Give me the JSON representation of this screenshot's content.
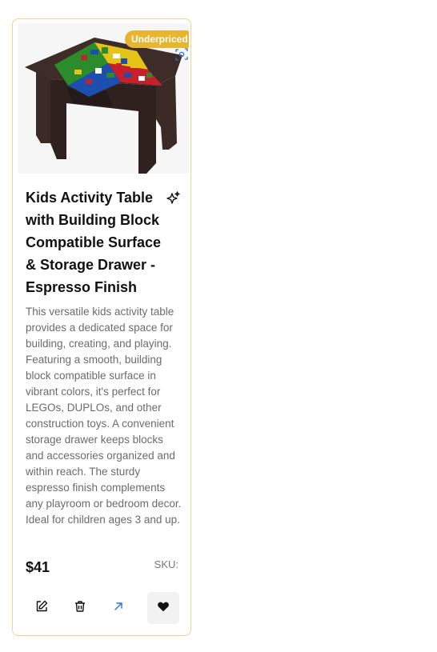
{
  "product": {
    "badge": "Underpriced",
    "title": "Kids Activity Table with Building Block Compatible Surface & Storage Drawer - Espresso Finish",
    "description": "This versatile kids activity table provides a dedicated space for building, creating, and playing. Featuring a smooth, building block compatible surface in vibrant colors, it's perfect for LEGOs, DUPLOs, and other construction toys. A convenient storage drawer keeps blocks and accessories organized and within reach. The sturdy espresso finish complements any playroom or bedroom decor. Ideal for children ages 3 and up.",
    "price": "$41",
    "sku_label": "SKU:"
  },
  "icons": {
    "scan": "scan-icon",
    "sparkle": "sparkle-icon",
    "edit": "edit-icon",
    "delete": "trash-icon",
    "open": "external-link-icon",
    "favorite": "heart-icon"
  },
  "colors": {
    "card_border": "#f1d48a",
    "badge_bg": "#e8b530",
    "link_accent": "#2b6fe0",
    "favorite_bg": "#f2f2f2"
  }
}
